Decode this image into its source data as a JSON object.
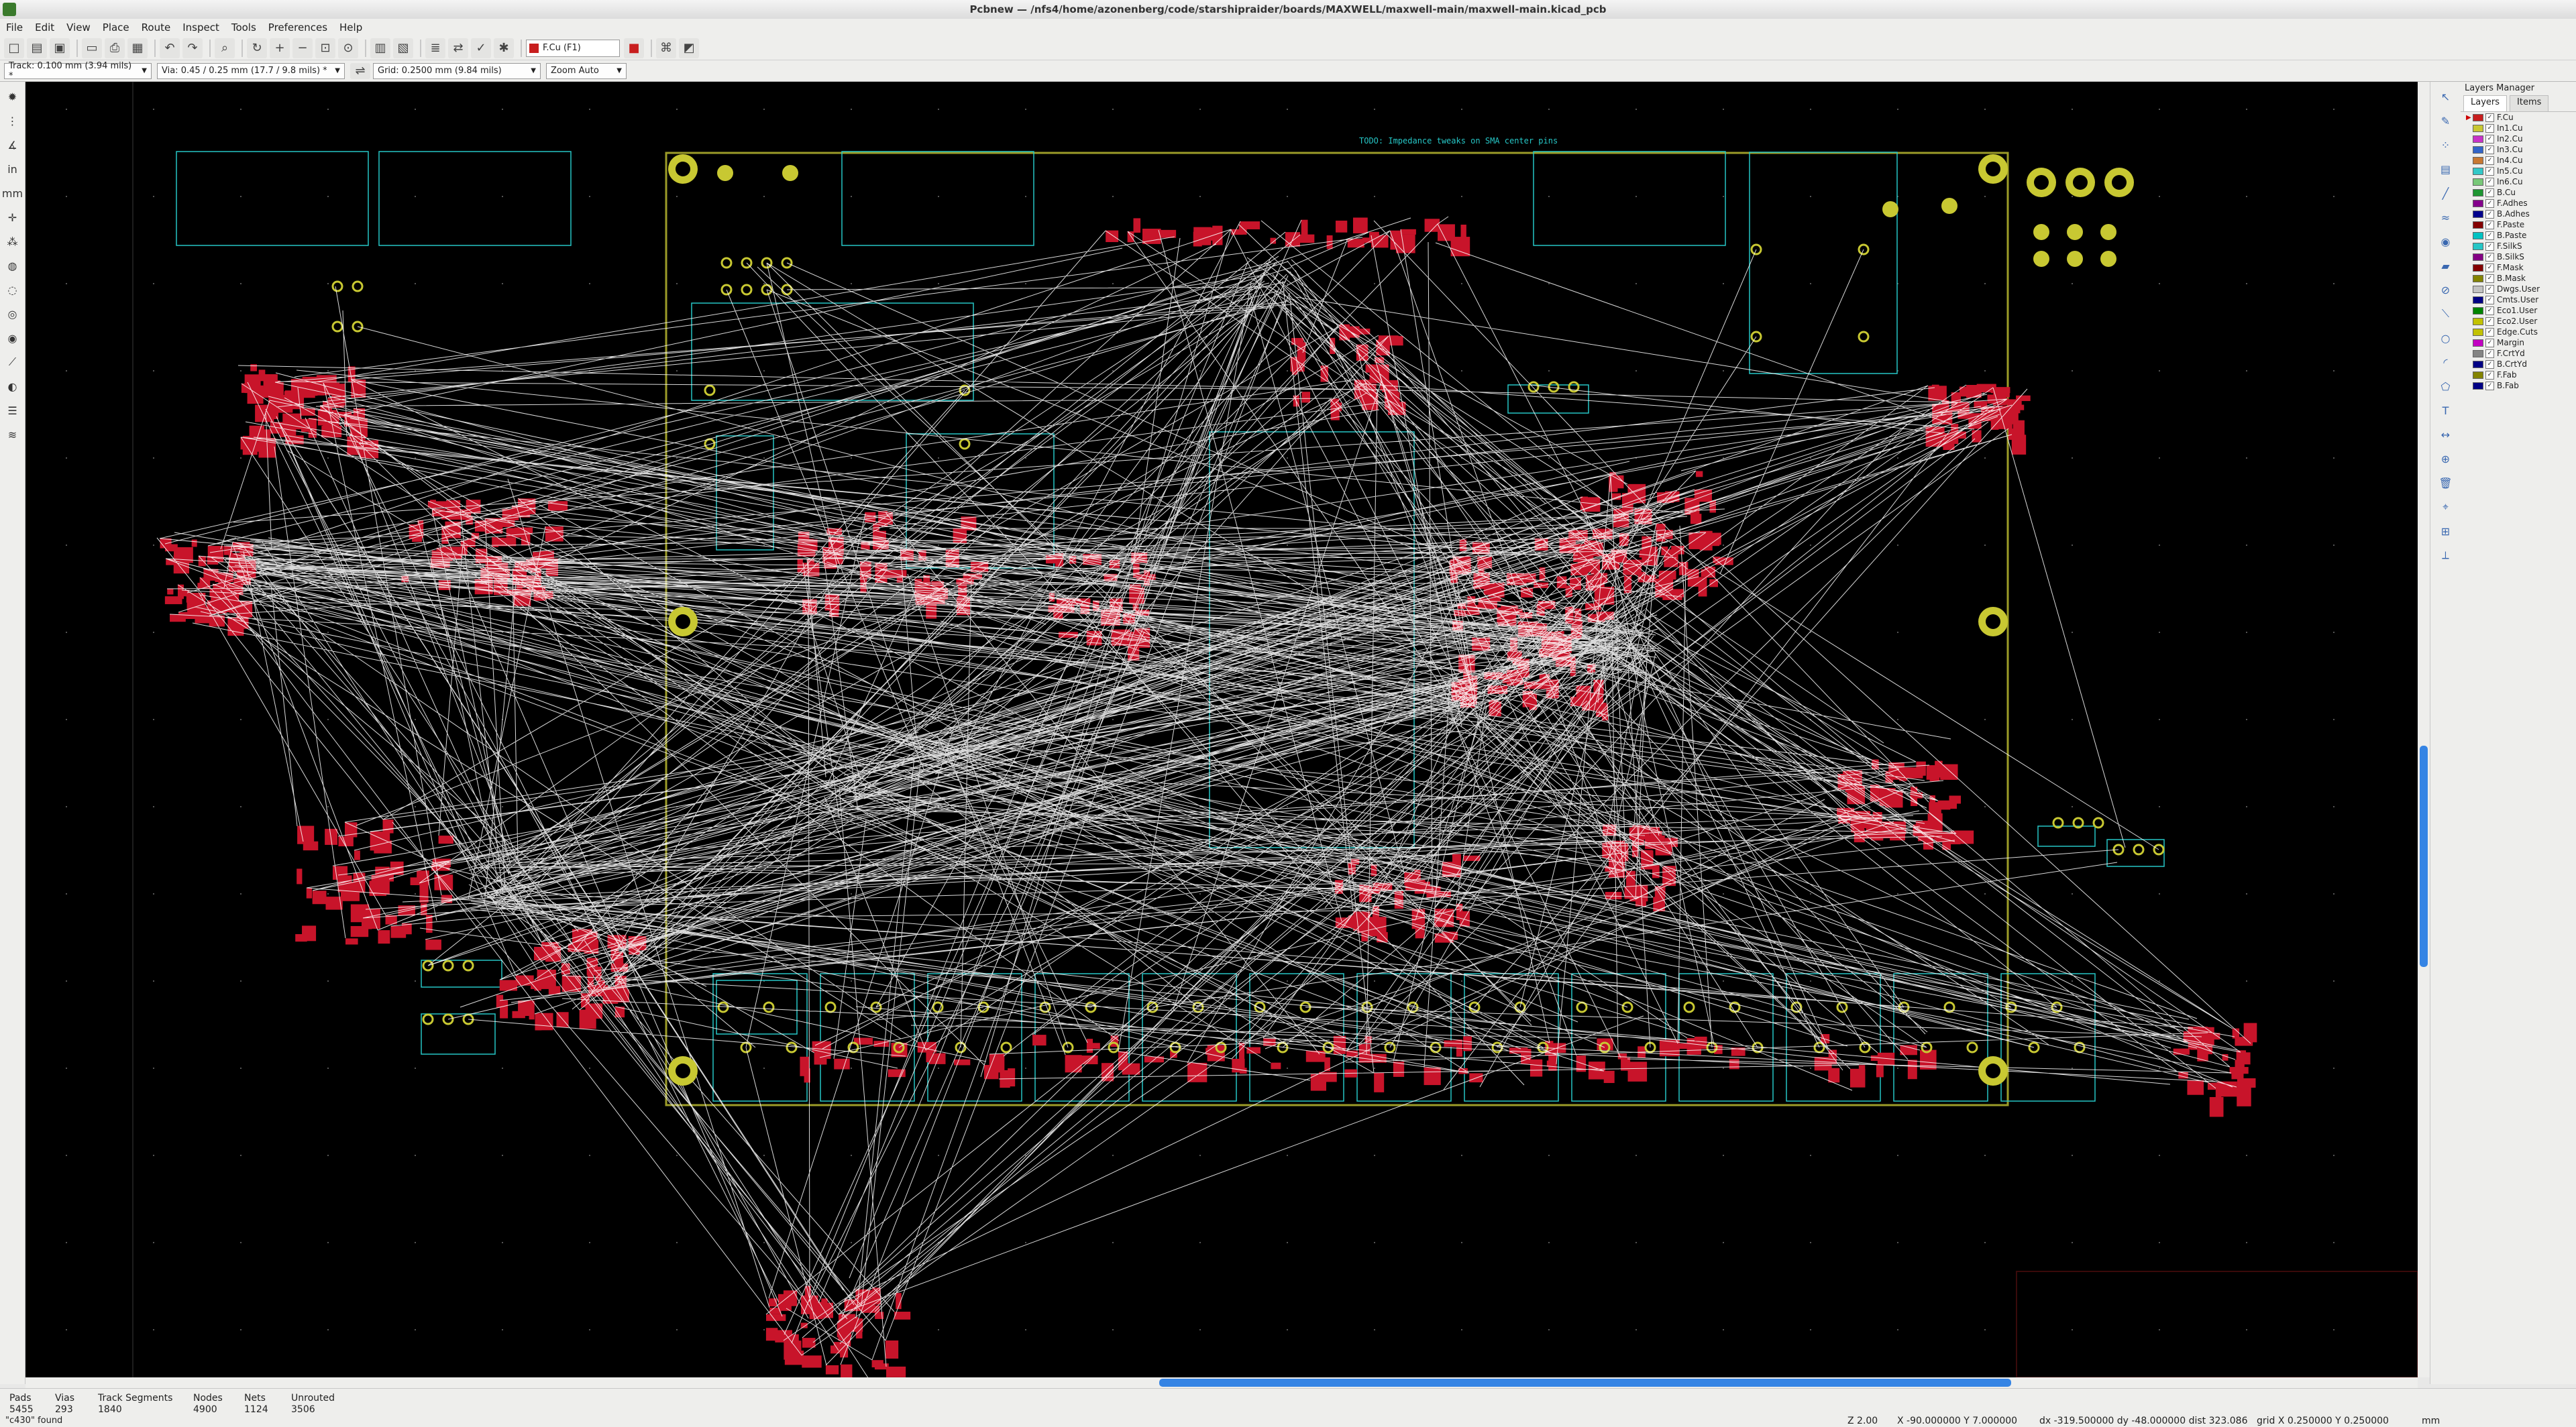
{
  "window": {
    "title": "Pcbnew — /nfs4/home/azonenberg/code/starshipraider/boards/MAXWELL/maxwell-main/maxwell-main.kicad_pcb"
  },
  "menu": [
    "File",
    "Edit",
    "View",
    "Place",
    "Route",
    "Inspect",
    "Tools",
    "Preferences",
    "Help"
  ],
  "toolbar": {
    "active_layer": "F.Cu (F1)",
    "active_layer_color": "#c81e1e"
  },
  "options": {
    "track": "Track: 0.100 mm (3.94 mils) *",
    "via": "Via: 0.45 / 0.25 mm (17.7 / 9.8 mils) *",
    "grid": "Grid: 0.2500 mm (9.84 mils)",
    "zoom": "Zoom Auto"
  },
  "board": {
    "annotation": "TODO: Impedance tweaks on SMA center pins",
    "silk_color": "#26c6c6",
    "pad_color": "#c8142a",
    "edge_color": "#c8c832",
    "ratsnest_color": "#ffffff"
  },
  "layers_manager": {
    "title": "Layers Manager",
    "tabs": [
      "Layers",
      "Items"
    ],
    "layers": [
      {
        "name": "F.Cu",
        "color": "#c81e1e",
        "active": true
      },
      {
        "name": "In1.Cu",
        "color": "#c8c832"
      },
      {
        "name": "In2.Cu",
        "color": "#c832c8"
      },
      {
        "name": "In3.Cu",
        "color": "#3264c8"
      },
      {
        "name": "In4.Cu",
        "color": "#c87832"
      },
      {
        "name": "In5.Cu",
        "color": "#32c8c8"
      },
      {
        "name": "In6.Cu",
        "color": "#78c878"
      },
      {
        "name": "B.Cu",
        "color": "#1e9632"
      },
      {
        "name": "F.Adhes",
        "color": "#84008c"
      },
      {
        "name": "B.Adhes",
        "color": "#00008c"
      },
      {
        "name": "F.Paste",
        "color": "#840000"
      },
      {
        "name": "B.Paste",
        "color": "#00c2c2"
      },
      {
        "name": "F.SilkS",
        "color": "#26c6c6"
      },
      {
        "name": "B.SilkS",
        "color": "#840084"
      },
      {
        "name": "F.Mask",
        "color": "#840000"
      },
      {
        "name": "B.Mask",
        "color": "#848400"
      },
      {
        "name": "Dwgs.User",
        "color": "#c2c2c2"
      },
      {
        "name": "Cmts.User",
        "color": "#000084"
      },
      {
        "name": "Eco1.User",
        "color": "#008400"
      },
      {
        "name": "Eco2.User",
        "color": "#c2c200"
      },
      {
        "name": "Edge.Cuts",
        "color": "#c2c200"
      },
      {
        "name": "Margin",
        "color": "#c200c2"
      },
      {
        "name": "F.CrtYd",
        "color": "#848484"
      },
      {
        "name": "B.CrtYd",
        "color": "#000084"
      },
      {
        "name": "F.Fab",
        "color": "#848400"
      },
      {
        "name": "B.Fab",
        "color": "#000084"
      }
    ]
  },
  "status": {
    "pads_label": "Pads",
    "pads": "5455",
    "vias_label": "Vias",
    "vias": "293",
    "tracks_label": "Track Segments",
    "tracks": "1840",
    "nodes_label": "Nodes",
    "nodes": "4900",
    "nets_label": "Nets",
    "nets": "1124",
    "unrouted_label": "Unrouted",
    "unrouted": "3506",
    "message": "\"c430\" found",
    "zoom": "Z 2.00",
    "xy": "X -90.000000  Y 7.000000",
    "delta": "dx -319.500000  dy -48.000000  dist 323.086",
    "grid": "grid X 0.250000  Y 0.250000",
    "units": "mm"
  }
}
